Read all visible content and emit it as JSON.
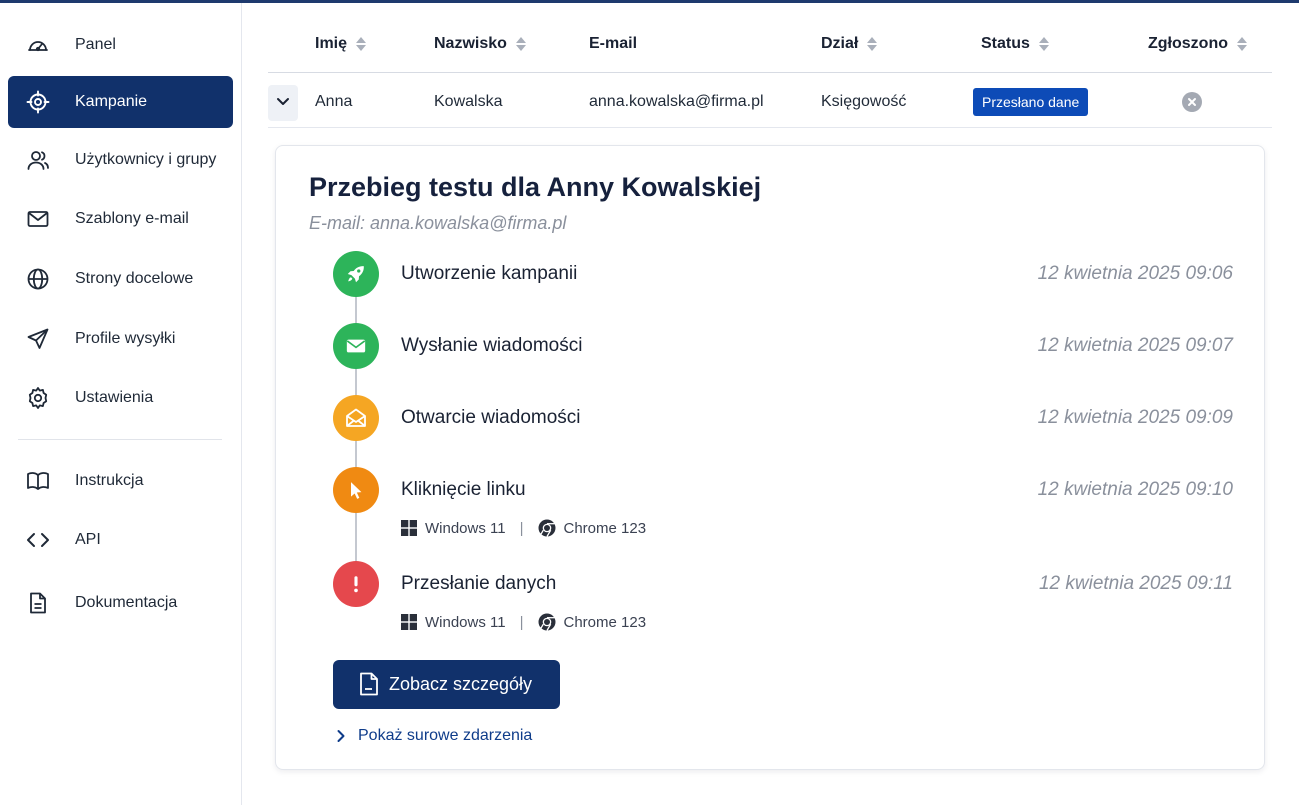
{
  "sidebar": {
    "items": [
      {
        "label": "Panel",
        "icon": "gauge-icon",
        "active": false
      },
      {
        "label": "Kampanie",
        "icon": "crosshair-icon",
        "active": true
      },
      {
        "label": "Użytkownicy i grupy",
        "icon": "users-icon",
        "active": false
      },
      {
        "label": "Szablony e-mail",
        "icon": "mail-icon",
        "active": false
      },
      {
        "label": "Strony docelowe",
        "icon": "globe-icon",
        "active": false
      },
      {
        "label": "Profile wysyłki",
        "icon": "send-icon",
        "active": false
      },
      {
        "label": "Ustawienia",
        "icon": "gear-icon",
        "active": false
      },
      {
        "label": "Instrukcja",
        "icon": "book-icon",
        "active": false
      },
      {
        "label": "API",
        "icon": "code-icon",
        "active": false
      },
      {
        "label": "Dokumentacja",
        "icon": "document-icon",
        "active": false
      }
    ]
  },
  "table": {
    "columns": [
      "Imię",
      "Nazwisko",
      "E-mail",
      "Dział",
      "Status",
      "Zgłoszono"
    ],
    "row": {
      "first_name": "Anna",
      "last_name": "Kowalska",
      "email": "anna.kowalska@firma.pl",
      "department": "Księgowość",
      "status": "Przesłano dane"
    }
  },
  "detail": {
    "title": "Przebieg testu dla Anny Kowalskiej",
    "subtitle": "E-mail: anna.kowalska@firma.pl",
    "steps": [
      {
        "title": "Utworzenie kampanii",
        "time": "12 kwietnia 2025 09:06",
        "icon": "rocket-icon",
        "color": "#2db45a"
      },
      {
        "title": "Wysłanie wiadomości",
        "time": "12 kwietnia 2025 09:07",
        "icon": "envelope-icon",
        "color": "#2db45a"
      },
      {
        "title": "Otwarcie wiadomości",
        "time": "12 kwietnia 2025 09:09",
        "icon": "envelope-open-icon",
        "color": "#f5a623"
      },
      {
        "title": "Kliknięcie linku",
        "time": "12 kwietnia 2025 09:10",
        "icon": "cursor-icon",
        "color": "#f08a12",
        "os": "Windows 11",
        "browser": "Chrome 123"
      },
      {
        "title": "Przesłanie danych",
        "time": "12 kwietnia 2025 09:11",
        "icon": "exclamation-icon",
        "color": "#e5484d",
        "os": "Windows 11",
        "browser": "Chrome 123"
      }
    ],
    "meta_separator": "|",
    "details_button": "Zobacz szczegóły",
    "raw_events_link": "Pokaż surowe zdarzenia"
  },
  "colors": {
    "primary": "#11316b",
    "badge": "#0d4bb7",
    "success": "#2db45a",
    "warning": "#f5a623",
    "click": "#f08a12",
    "danger": "#e5484d"
  }
}
